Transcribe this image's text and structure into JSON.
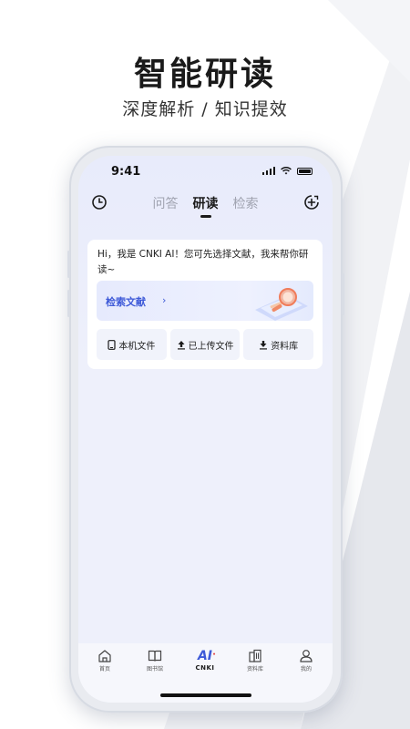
{
  "promo": {
    "title": "智能研读",
    "subtitle": "深度解析 / 知识提效"
  },
  "status_bar": {
    "time": "9:41",
    "icons": [
      "signal-icon",
      "wifi-icon",
      "battery-icon"
    ]
  },
  "top_nav": {
    "left_icon": "clock-icon",
    "right_icon": "plus-circle-icon",
    "tabs": [
      {
        "label": "问答",
        "active": false
      },
      {
        "label": "研读",
        "active": true
      },
      {
        "label": "检索",
        "active": false
      }
    ]
  },
  "card": {
    "greeting": "Hi，我是 CNKI AI！您可先选择文献，我来帮你研读~",
    "search_banner": {
      "label": "检索文献",
      "chevron": "›"
    },
    "actions": [
      {
        "label": "本机文件",
        "icon": "phone-icon"
      },
      {
        "label": "已上传文件",
        "icon": "upload-icon"
      },
      {
        "label": "资料库",
        "icon": "download-icon"
      }
    ]
  },
  "bottom_nav": {
    "items": [
      {
        "label": "首页",
        "icon": "home-icon"
      },
      {
        "label": "图书馆",
        "icon": "book-icon"
      },
      {
        "label": "CNKI",
        "icon": "ai-logo-icon",
        "logo_text": "AI"
      },
      {
        "label": "资料库",
        "icon": "building-icon"
      },
      {
        "label": "我的",
        "icon": "user-icon"
      }
    ]
  },
  "colors": {
    "accent": "#3e5ad8",
    "screen_bg": "#eef0fb",
    "text_primary": "#1a1a1a"
  }
}
